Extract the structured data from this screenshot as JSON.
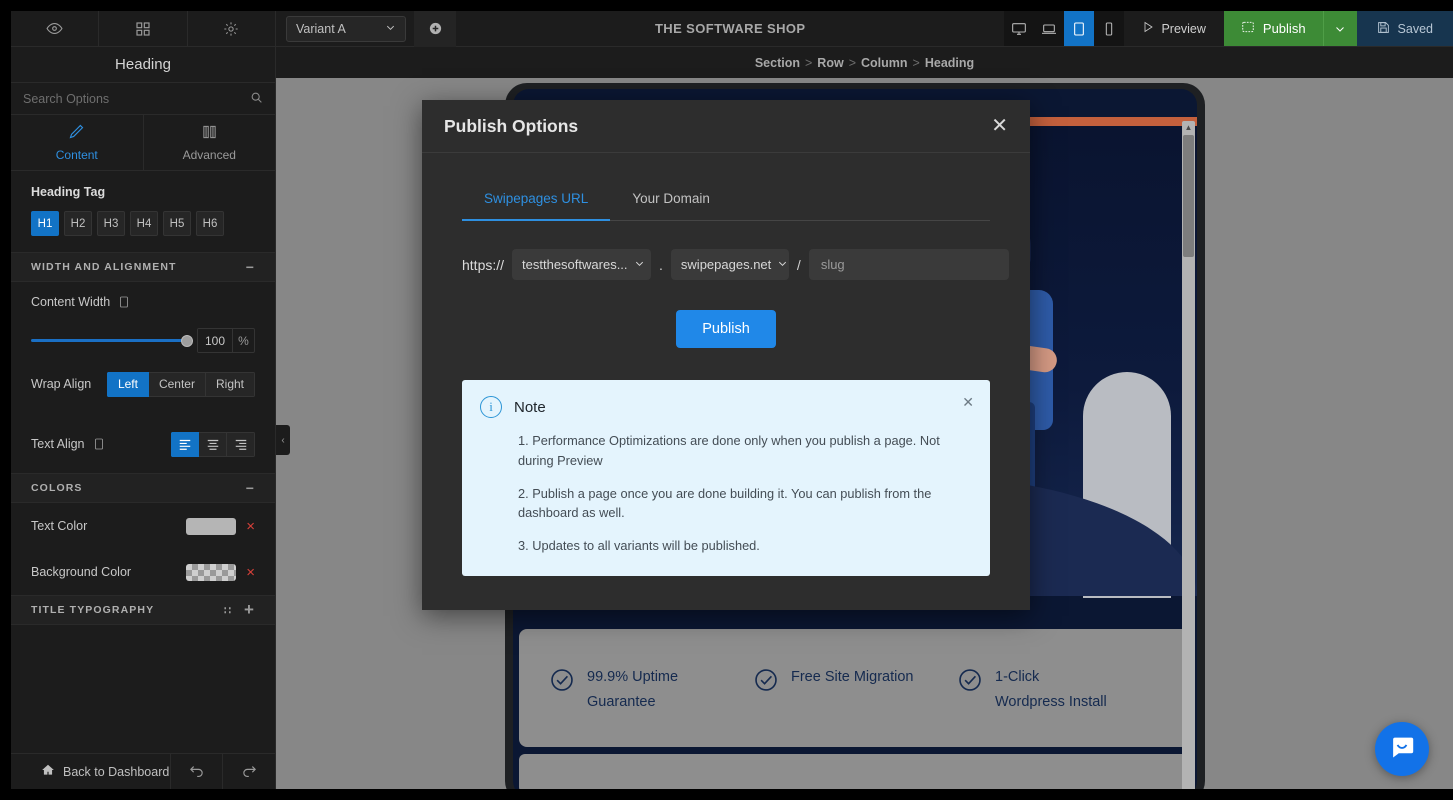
{
  "sidebar": {
    "tools": [
      {
        "name": "eye-icon",
        "title": "Preview"
      },
      {
        "name": "grid-icon",
        "title": "Blocks"
      },
      {
        "name": "gear-icon",
        "title": "Settings"
      }
    ],
    "panel_title": "Heading",
    "search": {
      "placeholder": "Search Options",
      "value": ""
    },
    "tabs": [
      {
        "label": "Content",
        "active": true
      },
      {
        "label": "Advanced",
        "active": false
      }
    ],
    "heading_tag": {
      "label": "Heading Tag",
      "options": [
        "H1",
        "H2",
        "H3",
        "H4",
        "H5",
        "H6"
      ],
      "selected": "H1"
    },
    "width_alignment": {
      "title": "WIDTH AND ALIGNMENT",
      "collapse_glyph": "−",
      "content_width": {
        "label": "Content Width",
        "value": "100",
        "unit": "%",
        "percent": 100
      },
      "wrap_align": {
        "label": "Wrap Align",
        "options": [
          "Left",
          "Center",
          "Right"
        ],
        "selected": "Left"
      },
      "text_align": {
        "label": "Text Align",
        "options": [
          "align-left",
          "align-center",
          "align-right"
        ],
        "selected": "align-left"
      }
    },
    "colors": {
      "title": "COLORS",
      "collapse_glyph": "−",
      "text_color": {
        "label": "Text Color",
        "swatch": "#b5b5b5",
        "clear_glyph": "×"
      },
      "background_color": {
        "label": "Background Color",
        "swatch": "transparent",
        "clear_glyph": "×"
      }
    },
    "title_typography": {
      "title": "TITLE TYPOGRAPHY",
      "drag_glyph": "∷",
      "add_glyph": "+"
    },
    "footer": {
      "back_label": "Back to Dashboard",
      "undo": "undo-icon",
      "redo": "redo-icon"
    },
    "collapse_handle": "‹"
  },
  "topbar": {
    "variant": {
      "value": "Variant A",
      "caret": "⌄"
    },
    "add_variant": "add-variant-icon",
    "page_title": "THE SOFTWARE SHOP",
    "devices": [
      {
        "name": "desktop",
        "active": false
      },
      {
        "name": "laptop",
        "active": false
      },
      {
        "name": "tablet",
        "active": true
      },
      {
        "name": "mobile",
        "active": false
      }
    ],
    "preview_label": "Preview",
    "publish_label": "Publish",
    "publish_caret": "⌄",
    "saved_label": "Saved"
  },
  "breadcrumb": {
    "items": [
      "Section",
      "Row",
      "Column",
      "Heading"
    ],
    "separator": ">"
  },
  "modal": {
    "title": "Publish Options",
    "close_glyph": "✕",
    "tabs": [
      {
        "label": "Swipepages URL",
        "active": true
      },
      {
        "label": "Your Domain",
        "active": false
      }
    ],
    "url": {
      "protocol": "https://",
      "subdomain": {
        "value": "testthesoftwares...",
        "caret": "⌄"
      },
      "dot": ".",
      "domain": {
        "value": "swipepages.net",
        "caret": "⌄"
      },
      "slash": "/",
      "slug": {
        "value": "",
        "placeholder": "slug"
      }
    },
    "publish_button": "Publish",
    "note": {
      "title": "Note",
      "icon": "info-icon",
      "icon_glyph": "i",
      "close_glyph": "✕",
      "items": [
        "1. Performance Optimizations are done only when you publish a page. Not during Preview",
        "2. Publish a page once you are done building it. You can publish from the dashboard as well.",
        "3. Updates to all variants will be published."
      ]
    }
  },
  "canvas": {
    "device": "tablet",
    "features": [
      {
        "icon": "check-circle-icon",
        "label": "99.9% Uptime Guarantee"
      },
      {
        "icon": "check-circle-icon",
        "label": "Free Site Migration"
      },
      {
        "icon": "check-circle-icon",
        "label": "1-Click Wordpress Install"
      }
    ],
    "scrollbar": {
      "up_glyph": "▲"
    }
  },
  "intercom": {
    "icon": "chat-bubble-icon"
  },
  "theme": {
    "accent_blue": "#2e8fe0",
    "select_blue": "#1273c6",
    "publish_green": "#3d8b36",
    "saved_navy": "#17354f",
    "panel_bg": "#1c1c1c",
    "modal_bg": "#2d2d2d",
    "canvas_bg": "#878787",
    "note_bg": "#e4f4fd"
  }
}
